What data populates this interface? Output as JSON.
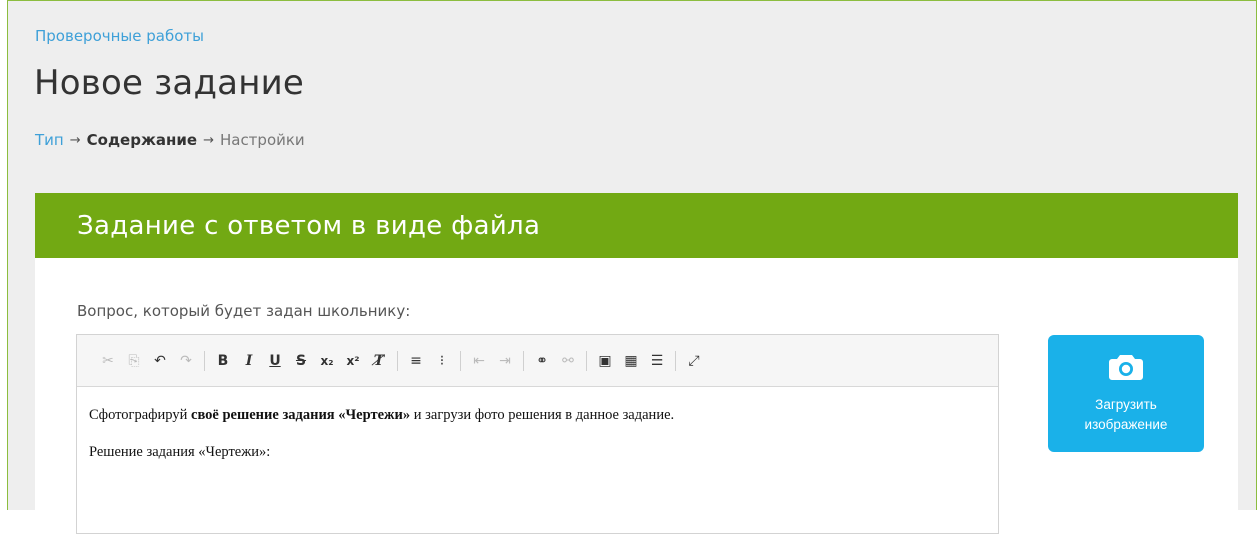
{
  "breadcrumb": {
    "parent": "Проверочные работы"
  },
  "page_title": "Новое задание",
  "steps": [
    {
      "label": "Тип",
      "state": "link"
    },
    {
      "label": "Содержание",
      "state": "current"
    },
    {
      "label": "Настройки",
      "state": "upcoming"
    }
  ],
  "step_arrow": "→",
  "card": {
    "title": "Задание с ответом в виде файла",
    "header_color": "#72a913",
    "question_label": "Вопрос, который будет задан школьнику:"
  },
  "toolbar": [
    {
      "icon": "cut-icon",
      "glyph": "✂",
      "enabled": false
    },
    {
      "icon": "copy-icon",
      "glyph": "⎘",
      "enabled": false
    },
    {
      "icon": "undo-icon",
      "glyph": "↶",
      "enabled": true
    },
    {
      "icon": "redo-icon",
      "glyph": "↷",
      "enabled": false
    },
    {
      "icon": "bold-icon",
      "glyph": "B",
      "enabled": true
    },
    {
      "icon": "italic-icon",
      "glyph": "I",
      "enabled": true
    },
    {
      "icon": "underline-icon",
      "glyph": "U",
      "enabled": true
    },
    {
      "icon": "strikethrough-icon",
      "glyph": "S",
      "enabled": true
    },
    {
      "icon": "subscript-icon",
      "glyph": "x₂",
      "enabled": true
    },
    {
      "icon": "superscript-icon",
      "glyph": "x²",
      "enabled": true
    },
    {
      "icon": "remove-format-icon",
      "glyph": "T̸",
      "enabled": true
    },
    {
      "icon": "numbered-list-icon",
      "glyph": "≡",
      "enabled": true
    },
    {
      "icon": "bulleted-list-icon",
      "glyph": "⁝",
      "enabled": true
    },
    {
      "icon": "outdent-icon",
      "glyph": "⇤",
      "enabled": false
    },
    {
      "icon": "indent-icon",
      "glyph": "⇥",
      "enabled": false
    },
    {
      "icon": "link-icon",
      "glyph": "⚭",
      "enabled": true
    },
    {
      "icon": "unlink-icon",
      "glyph": "⚯",
      "enabled": false
    },
    {
      "icon": "image-icon",
      "glyph": "▣",
      "enabled": true
    },
    {
      "icon": "table-icon",
      "glyph": "▦",
      "enabled": true
    },
    {
      "icon": "horizontal-rule-icon",
      "glyph": "☰",
      "enabled": true
    },
    {
      "icon": "maximize-icon",
      "glyph": "⤢",
      "enabled": true
    }
  ],
  "editor": {
    "line1_before": "Сфотографируй ",
    "line1_bold": "своё решение задания «Чертежи»",
    "line1_after": " и загрузи фото решения в данное задание.",
    "line2": "Решение задания «Чертежи»:"
  },
  "upload": {
    "label_line1": "Загрузить",
    "label_line2": "изображение",
    "icon": "camera-icon",
    "color": "#1ab1e9"
  }
}
